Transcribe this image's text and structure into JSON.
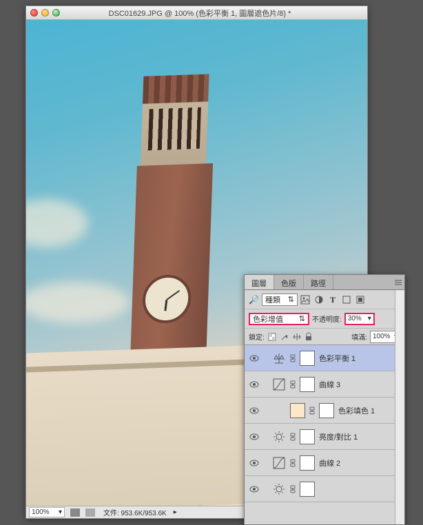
{
  "window": {
    "title": "DSC01629.JPG @ 100% (色彩平衡 1, 圖層遮色片/8) *"
  },
  "statusbar": {
    "zoom": "100%",
    "file_info": "文件: 953.6K/953.6K"
  },
  "panel": {
    "tabs": [
      "圖層",
      "色版",
      "路徑"
    ],
    "kind_dropdown": "種類",
    "blend_mode": "色彩增值",
    "opacity_label": "不透明度:",
    "opacity_value": "30%",
    "lock_label": "鎖定:",
    "fill_label": "填滿:",
    "fill_value": "100%"
  },
  "layers": [
    {
      "name": "色彩平衡 1",
      "selected": true,
      "icon": "balance",
      "fill": false
    },
    {
      "name": "曲線 3",
      "selected": false,
      "icon": "curves",
      "fill": false
    },
    {
      "name": "色彩填色 1",
      "selected": false,
      "icon": "solid",
      "fill": true
    },
    {
      "name": "亮度/對比 1",
      "selected": false,
      "icon": "brightness",
      "fill": false
    },
    {
      "name": "曲線 2",
      "selected": false,
      "icon": "curves",
      "fill": false
    },
    {
      "name": "",
      "selected": false,
      "icon": "brightness",
      "fill": false
    }
  ]
}
